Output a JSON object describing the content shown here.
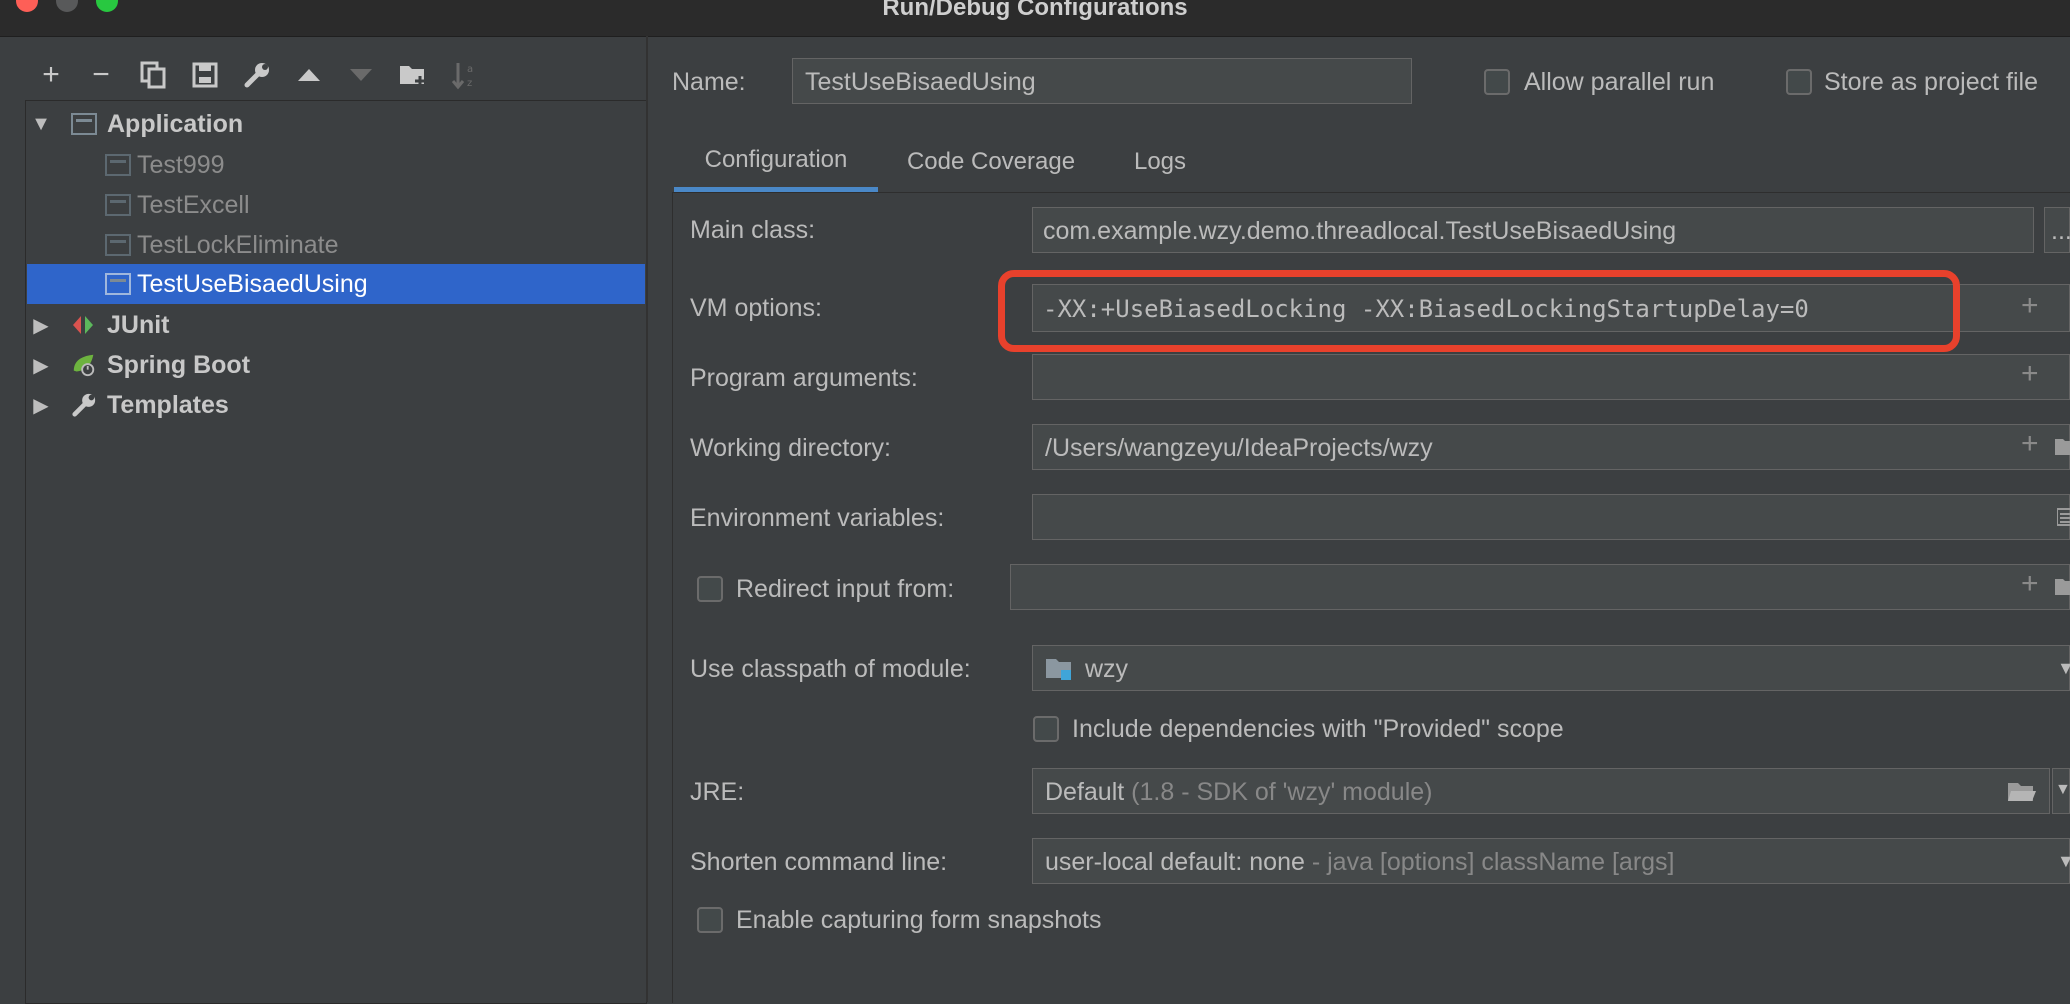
{
  "window": {
    "title": "Run/Debug Configurations",
    "colors": {
      "close": "#fe5f57",
      "minimize": "#58595a",
      "maximize": "#28c840",
      "selection": "#2f65ca",
      "highlight": "#e8412c",
      "tab_underline": "#4a88c7"
    }
  },
  "toolbar": {
    "add": "+",
    "remove": "−"
  },
  "tree": {
    "application_label": "Application",
    "app_items": [
      "Test999",
      "TestExcell",
      "TestLockEliminate",
      "TestUseBisaedUsing"
    ],
    "junit_label": "JUnit",
    "spring_boot_label": "Spring Boot",
    "templates_label": "Templates"
  },
  "header": {
    "name_label": "Name:",
    "name_value": "TestUseBisaedUsing",
    "allow_parallel_label": "Allow parallel run",
    "store_project_label": "Store as project file"
  },
  "tabs": [
    "Configuration",
    "Code Coverage",
    "Logs"
  ],
  "form": {
    "main_class_label": "Main class:",
    "main_class_value": "com.example.wzy.demo.threadlocal.TestUseBisaedUsing",
    "main_class_more": "...",
    "vm_options_label": "VM options:",
    "vm_options_value": "-XX:+UseBiasedLocking -XX:BiasedLockingStartupDelay=0",
    "program_args_label": "Program arguments:",
    "program_args_value": "",
    "working_dir_label": "Working directory:",
    "working_dir_value": "/Users/wangzeyu/IdeaProjects/wzy",
    "env_vars_label": "Environment variables:",
    "env_vars_value": "",
    "redirect_label": "Redirect input from:",
    "classpath_label": "Use classpath of module:",
    "classpath_value": "wzy",
    "include_deps_label": "Include dependencies with \"Provided\" scope",
    "jre_label": "JRE:",
    "jre_value": "Default",
    "jre_hint": "(1.8 - SDK of 'wzy' module)",
    "shorten_label": "Shorten command line:",
    "shorten_value": "user-local default: none",
    "shorten_hint": "- java [options] className [args]",
    "snapshots_label": "Enable capturing form snapshots"
  }
}
